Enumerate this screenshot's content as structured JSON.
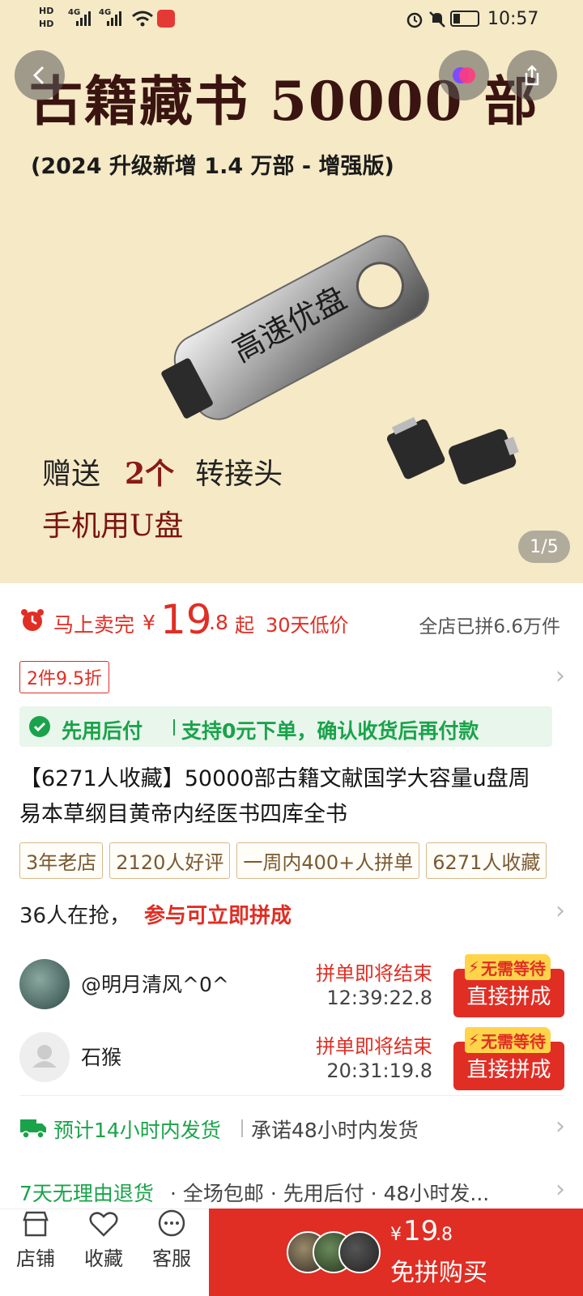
{
  "status_bar": {
    "hd1": "HD",
    "hd2": "HD",
    "net1": "4G",
    "net2": "4G",
    "time": "10:57"
  },
  "hero": {
    "title": "古籍藏书 50000 部",
    "subtitle": "(2024 升级新增 1.4 万部 - 增强版)",
    "usb_label": "高速优盘",
    "gift_prefix": "赠送",
    "gift_qty": "2个",
    "gift_suffix": "转接头",
    "phone_usb": "手机用U盘",
    "pager": "1/5"
  },
  "price": {
    "flash_label": "马上卖完",
    "currency": "¥",
    "integer": "19",
    "decimal": ".8",
    "suffix": "起",
    "low_price": "30天低价",
    "store_sold": "全店已拼6.6万件"
  },
  "discount": "2件9.5折",
  "pay_later": {
    "label": "先用后付",
    "desc": "支持0元下单，确认收货后再付款"
  },
  "product_title": "【6271人收藏】50000部古籍文献国学大容量u盘周易本草纲目黄帝内经医书四库全书",
  "tags": [
    "3年老店",
    "2120人好评",
    "一周内400+人拼单",
    "6271人收藏"
  ],
  "group": {
    "count_text": "36人在抢，",
    "join_text": "参与可立即拼成"
  },
  "orders": [
    {
      "name": "@明月清风^0^",
      "ending": "拼单即将结束",
      "timer": "12:39:22.8",
      "badge": "无需等待",
      "button": "直接拼成"
    },
    {
      "name": "石猴",
      "ending": "拼单即将结束",
      "timer": "20:31:19.8",
      "badge": "无需等待",
      "button": "直接拼成"
    }
  ],
  "shipping": {
    "estimate": "预计14小时内发货",
    "promise": "承诺48小时内发货"
  },
  "services": {
    "return": "7天无理由退货",
    "items": "· 全场包邮 · 先用后付 · 48小时发..."
  },
  "bottom_nav": {
    "store": "店铺",
    "favorite": "收藏",
    "service": "客服",
    "buy_currency": "¥",
    "buy_price": "19",
    "buy_decimal": ".8",
    "buy_label": "免拼购买"
  },
  "colors": {
    "accent": "#e02e24",
    "green": "#1aa34a",
    "hero_bg": "#f5e9c6"
  }
}
